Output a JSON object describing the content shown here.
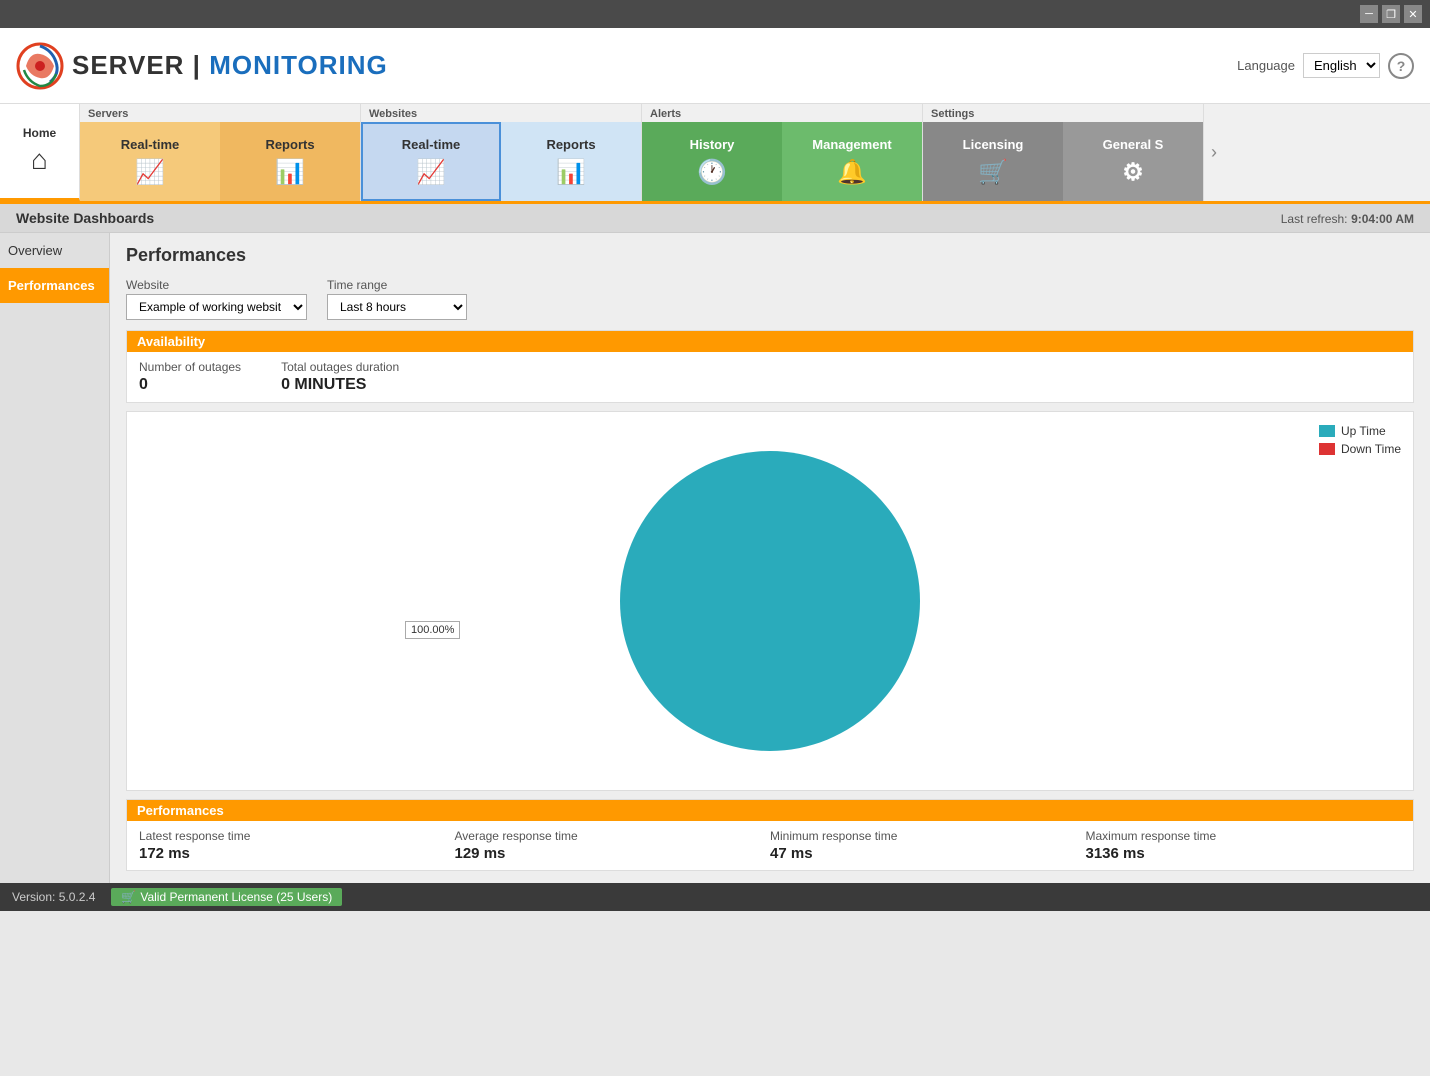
{
  "titlebar": {
    "minimize_label": "─",
    "restore_label": "❐",
    "close_label": "✕"
  },
  "header": {
    "logo_server": "SERVER",
    "logo_monitoring": "MONITORING",
    "language_label": "Language",
    "language_value": "English",
    "help_label": "?"
  },
  "navbar": {
    "home_label": "Home",
    "servers_group_label": "Servers",
    "servers_realtime_label": "Real-time",
    "servers_reports_label": "Reports",
    "websites_group_label": "Websites",
    "websites_realtime_label": "Real-time",
    "websites_reports_label": "Reports",
    "alerts_group_label": "Alerts",
    "alerts_history_label": "History",
    "alerts_management_label": "Management",
    "settings_group_label": "Settings",
    "settings_licensing_label": "Licensing",
    "settings_general_label": "General S"
  },
  "dashboard": {
    "title": "Website Dashboards",
    "last_refresh_label": "Last refresh:",
    "last_refresh_time": "9:04:00 AM"
  },
  "sidebar": {
    "overview_label": "Overview",
    "performances_label": "Performances"
  },
  "performances": {
    "title": "Performances",
    "website_label": "Website",
    "website_value": "Example of working websit",
    "timerange_label": "Time range",
    "timerange_value": "Last 8 hours",
    "availability_section": "Availability",
    "number_of_outages_label": "Number of outages",
    "number_of_outages_value": "0",
    "total_outages_label": "Total outages duration",
    "total_outages_value": "0 MINUTES",
    "uptime_label": "Up Time",
    "downtime_label": "Down Time",
    "pie_percent": "100.00%",
    "performances_section": "Performances",
    "latest_response_label": "Latest response time",
    "latest_response_value": "172 ms",
    "average_response_label": "Average response time",
    "average_response_value": "129 ms",
    "minimum_response_label": "Minimum response time",
    "minimum_response_value": "47 ms",
    "maximum_response_label": "Maximum response time",
    "maximum_response_value": "3136 ms",
    "uptime_color": "#2aabbb",
    "downtime_color": "#dd3333"
  },
  "statusbar": {
    "version_label": "Version: 5.0.2.4",
    "license_icon": "🛒",
    "license_label": "Valid Permanent License (25 Users)"
  }
}
